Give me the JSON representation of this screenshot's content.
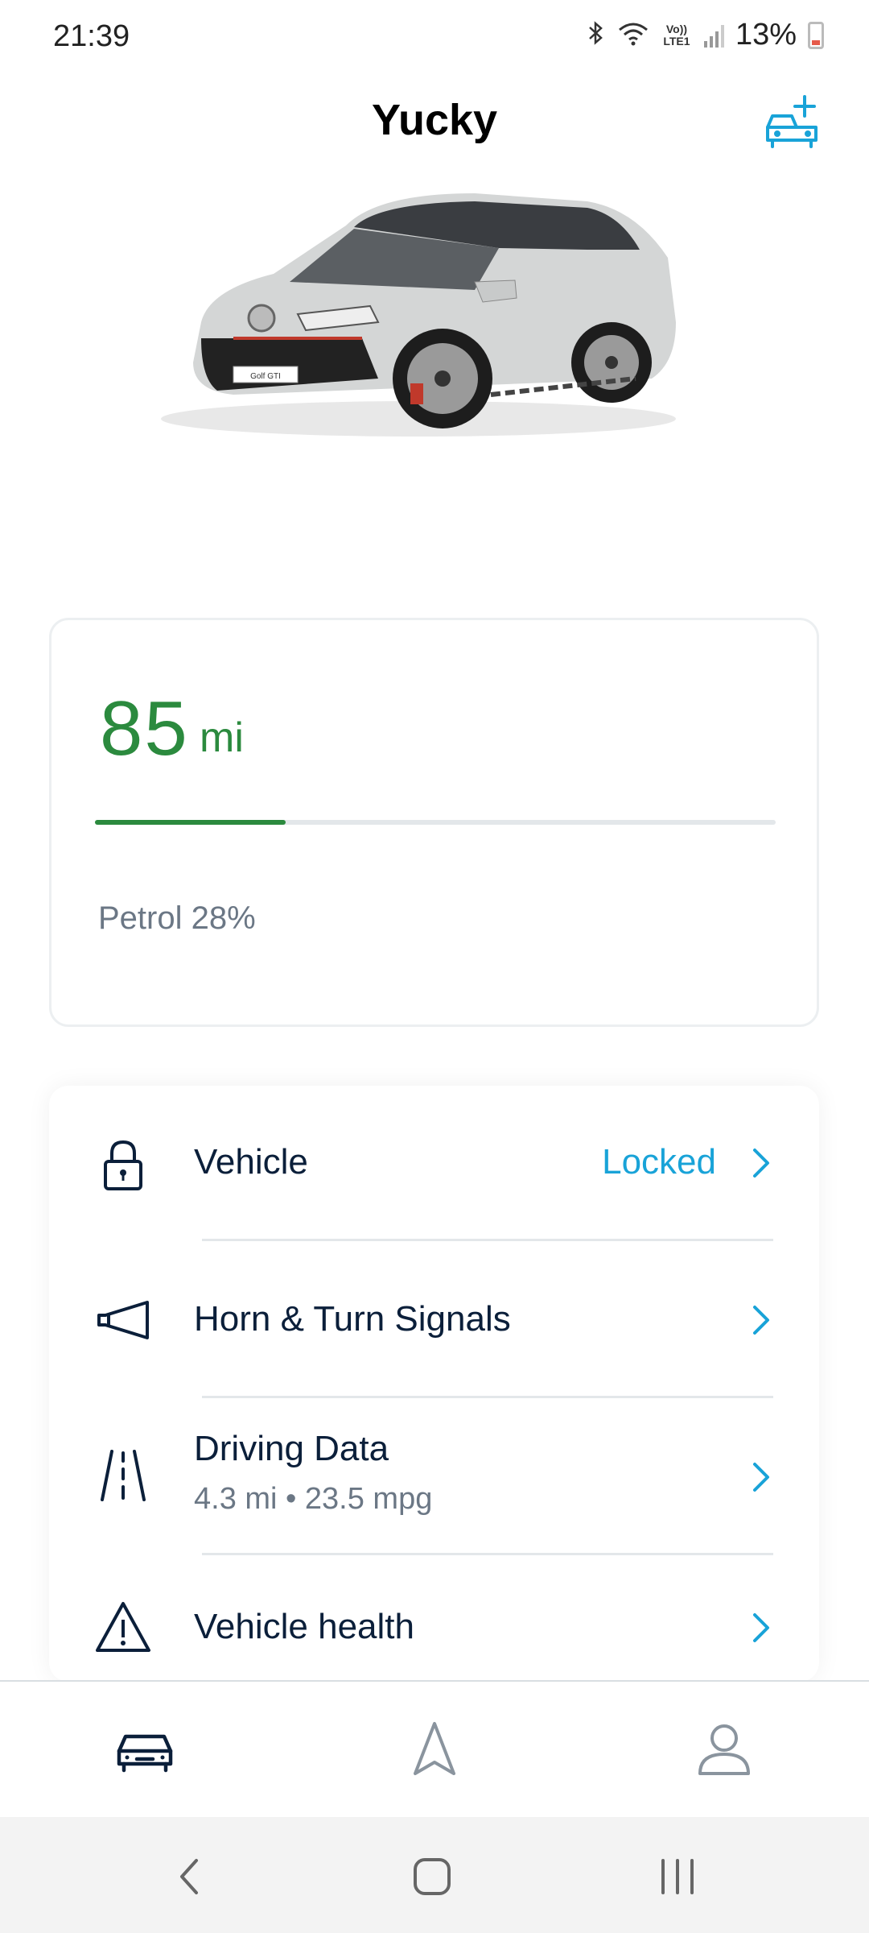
{
  "status_bar": {
    "time": "21:39",
    "battery_percent": "13%",
    "volte_label": "Vo)) LTE1",
    "icons": [
      "bluetooth-icon",
      "wifi-icon",
      "volte-icon",
      "signal-icon",
      "battery-icon"
    ]
  },
  "header": {
    "title": "Yucky",
    "add_vehicle_icon": "car-plus-icon"
  },
  "vehicle": {
    "image": "car-image"
  },
  "range": {
    "value": "85",
    "unit": "mi",
    "fuel_label": "Petrol 28%",
    "fuel_level_fraction": 0.28,
    "accent_color": "#2b8a3e"
  },
  "actions": [
    {
      "title": "Vehicle",
      "status": "Locked",
      "icon": "lock-icon"
    },
    {
      "title": "Horn & Turn Signals",
      "icon": "horn-icon"
    },
    {
      "title": "Driving Data",
      "subtitle": "4.3 mi • 23.5 mpg",
      "icon": "road-icon"
    },
    {
      "title": "Vehicle health",
      "icon": "warning-icon"
    }
  ],
  "bottom_nav": [
    "car-tab-icon",
    "navigation-tab-icon",
    "profile-tab-icon"
  ],
  "system_nav": [
    "back-icon",
    "home-icon",
    "recents-icon"
  ],
  "colors": {
    "accent_blue": "#19a3d8",
    "navy": "#0b1f3a",
    "muted": "#6b7785"
  }
}
